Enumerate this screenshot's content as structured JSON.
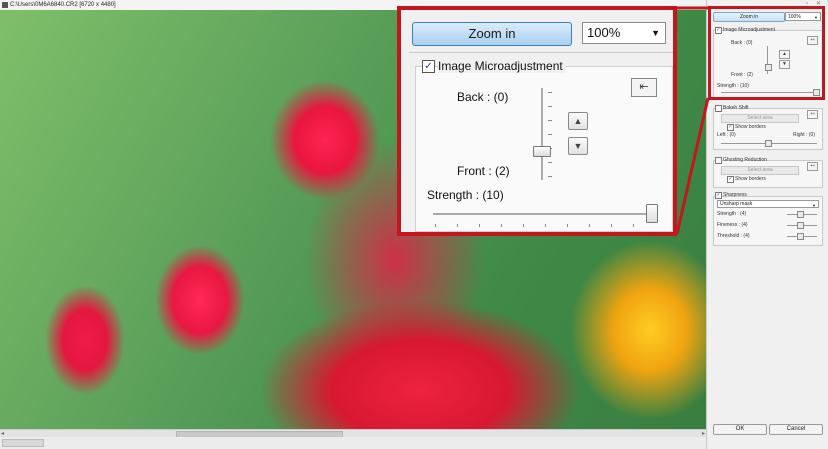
{
  "window": {
    "title": "C:\\Users\\0M6A6840.CR2 [6720 x 4480]"
  },
  "photo": {
    "subject": ""
  },
  "zoom": {
    "zoom_in_label": "Zoom in",
    "zoom_level": "100%"
  },
  "image_microadjustment": {
    "label": "Image Microadjustment",
    "checked": true,
    "back_label": "Back : (0)",
    "front_label": "Front : (2)",
    "strength_label": "Strength : (10)"
  },
  "bokeh_shift": {
    "label": "Bokeh Shift",
    "checked": false,
    "select_area_label": "Select area",
    "show_borders_label": "Show borders",
    "left_label": "Left : (0)",
    "right_label": "Right : (0)"
  },
  "ghosting_reduction": {
    "label": "Ghosting Reduction",
    "checked": false,
    "select_area_label": "Select area",
    "show_borders_label": "Show borders"
  },
  "sharpness": {
    "label": "Sharpness",
    "checked": true,
    "mode_value": "Unsharp mask",
    "strength_label": "Strength : (4)",
    "fineness_label": "Fineness : (4)",
    "threshold_label": "Threshold : (4)"
  },
  "dialog": {
    "ok_label": "OK",
    "cancel_label": "Cancel"
  },
  "colors": {
    "callout_red": "#c4161c",
    "zoom_button_blue": "#a9d0f1"
  },
  "icons": {
    "reset": "reset-icon",
    "up": "chevron-up-icon",
    "down": "chevron-down-icon",
    "dropdown": "dropdown-arrow-icon"
  }
}
